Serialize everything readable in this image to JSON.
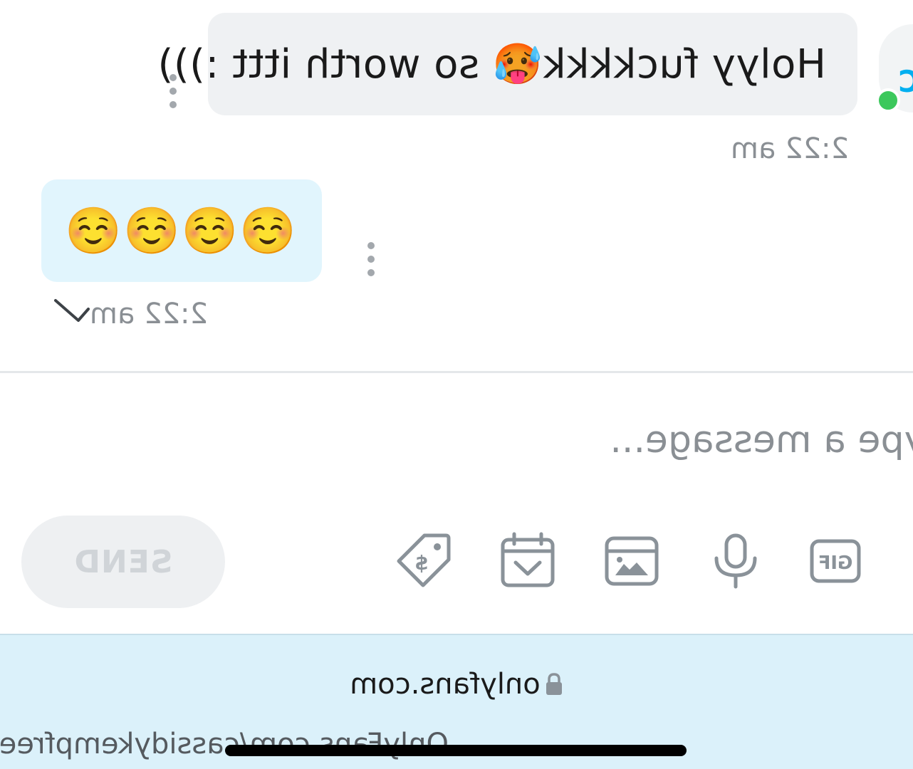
{
  "chat": {
    "avatar_initial": "C",
    "messages": [
      {
        "direction": "incoming",
        "text_before": "Holyy fuckkkk",
        "emoji": "🥵",
        "text_after": "so worth ittt :)))",
        "time": "2:22 am"
      },
      {
        "direction": "outgoing",
        "text": "☺️☺️☺️☺️",
        "time": "2:22 am"
      }
    ]
  },
  "composer": {
    "placeholder": "Type a message...",
    "value": "",
    "send_label": "SEND",
    "tools": [
      "gif-icon",
      "microphone-icon",
      "media-icon",
      "schedule-icon",
      "price-tag-icon"
    ]
  },
  "browser": {
    "domain": "onlyfans.com",
    "page_url": "OnlyFans.com/cassidykempfree"
  },
  "colors": {
    "incoming_bubble": "#eff1f3",
    "outgoing_bubble": "#e1f5fd",
    "online": "#3cc85c",
    "icon": "#8a9299",
    "browser_bar": "#dbf1fa"
  }
}
